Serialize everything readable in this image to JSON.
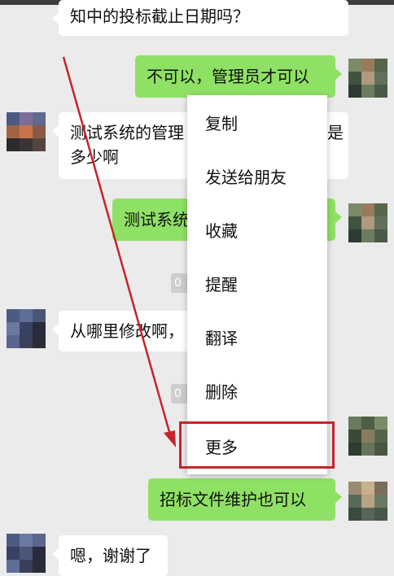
{
  "messages": [
    {
      "id": "m1",
      "side": "left",
      "text": "知中的投标截止日期吗？"
    },
    {
      "id": "m2",
      "side": "right",
      "text": "不可以，管理员才可以"
    },
    {
      "id": "m3",
      "side": "left",
      "line1": "测试系统的管理",
      "line2": "多少啊",
      "overflow": "是"
    },
    {
      "id": "m4",
      "side": "right",
      "text": "测试系统"
    },
    {
      "id": "m5",
      "side": "left",
      "text": "从哪里修改啊，"
    },
    {
      "id": "m6",
      "side": "right",
      "text": "招标文件维护也可以"
    },
    {
      "id": "m7",
      "side": "left",
      "text": "嗯，谢谢了"
    }
  ],
  "time_tags": [
    "0",
    "0"
  ],
  "context_menu": {
    "items": [
      "复制",
      "发送给朋友",
      "收藏",
      "提醒",
      "翻译",
      "删除",
      "更多"
    ],
    "highlighted": "更多"
  },
  "colors": {
    "chat_background": "#ebebeb",
    "bubble_self": "#8fe165",
    "bubble_other": "#ffffff",
    "annotation_red": "#c5242b"
  }
}
